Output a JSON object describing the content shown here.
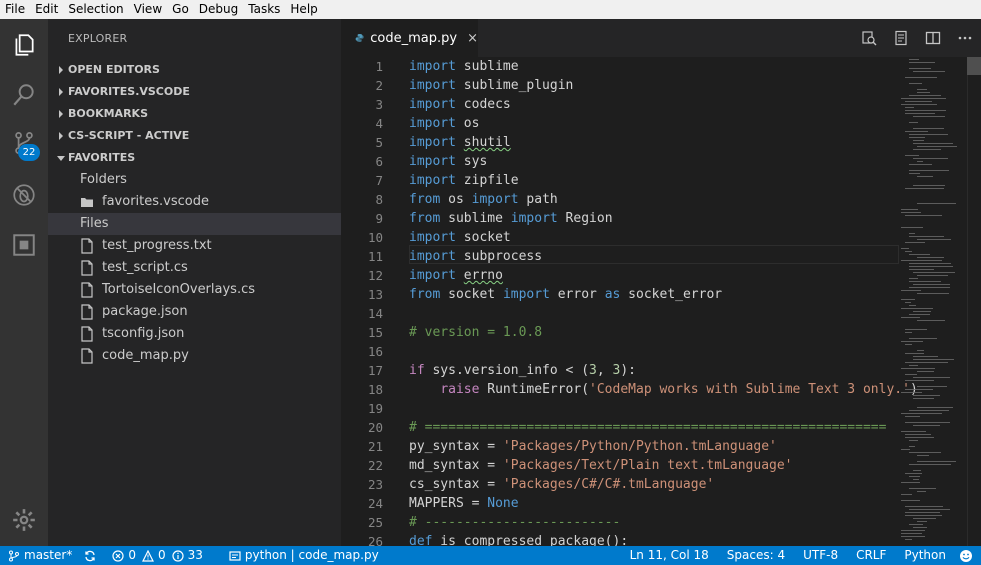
{
  "menu": [
    "File",
    "Edit",
    "Selection",
    "View",
    "Go",
    "Debug",
    "Tasks",
    "Help"
  ],
  "activity": {
    "scm_badge": "22"
  },
  "sidebar": {
    "title": "EXPLORER",
    "sections": [
      {
        "label": "OPEN EDITORS",
        "expanded": false
      },
      {
        "label": "FAVORITES.VSCODE",
        "expanded": false
      },
      {
        "label": "BOOKMARKS",
        "expanded": false
      },
      {
        "label": "CS-SCRIPT - ACTIVE",
        "expanded": false
      },
      {
        "label": "FAVORITES",
        "expanded": true
      }
    ],
    "favorites": {
      "folders_label": "Folders",
      "folder_item": "favorites.vscode",
      "files_label": "Files",
      "files": [
        "test_progress.txt",
        "test_script.cs",
        "TortoiseIconOverlays.cs",
        "package.json",
        "tsconfig.json",
        "code_map.py"
      ]
    }
  },
  "tab": {
    "label": "code_map.py",
    "close": "×"
  },
  "editor": {
    "line_numbers": [
      "1",
      "2",
      "3",
      "4",
      "5",
      "6",
      "7",
      "8",
      "9",
      "10",
      "11",
      "12",
      "13",
      "14",
      "15",
      "16",
      "17",
      "18",
      "19",
      "20",
      "21",
      "22",
      "23",
      "24",
      "25",
      "26"
    ]
  },
  "status": {
    "branch": "master*",
    "errors": "0",
    "warnings": "0",
    "info": "33",
    "context": "python | code_map.py",
    "position": "Ln 11, Col 18",
    "spaces": "Spaces: 4",
    "encoding": "UTF-8",
    "eol": "CRLF",
    "language": "Python"
  },
  "colors": {
    "accent": "#007acc",
    "keyword": "#569cd6",
    "control": "#c586c0",
    "string": "#ce9178",
    "comment": "#6a9955"
  }
}
